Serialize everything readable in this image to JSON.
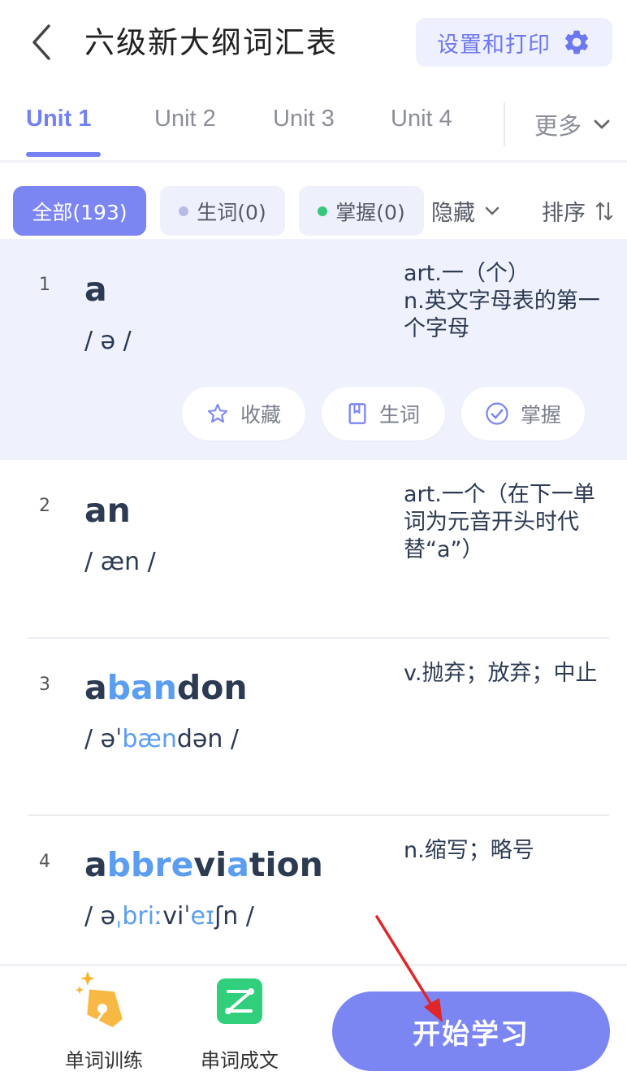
{
  "header": {
    "title": "六级新大纲词汇表",
    "settings_label": "设置和打印"
  },
  "tabs": {
    "items": [
      "Unit 1",
      "Unit 2",
      "Unit 3",
      "Unit 4"
    ],
    "active": "Unit 1",
    "more_label": "更多"
  },
  "filters": {
    "all_label": "全部(193)",
    "new_label": "生词(0)",
    "known_label": "掌握(0)",
    "hide_label": "隐藏",
    "sort_label": "排序"
  },
  "words": [
    {
      "num": "1",
      "word": "a",
      "word_parts": [
        {
          "t": "a",
          "hl": false
        }
      ],
      "phonetic_parts": [
        {
          "t": "/ ə /",
          "hl": false
        }
      ],
      "meaning": "art.一（个）\nn.英文字母表的第一个字母",
      "selected": true
    },
    {
      "num": "2",
      "word": "an",
      "word_parts": [
        {
          "t": "an",
          "hl": false
        }
      ],
      "phonetic_parts": [
        {
          "t": "/ æn /",
          "hl": false
        }
      ],
      "meaning": "art.一个（在下一单词为元音开头时代替“a”）",
      "selected": false
    },
    {
      "num": "3",
      "word": "abandon",
      "word_parts": [
        {
          "t": "a",
          "hl": false
        },
        {
          "t": "ban",
          "hl": true
        },
        {
          "t": "don",
          "hl": false
        }
      ],
      "phonetic_parts": [
        {
          "t": "/ əˈ",
          "hl": false
        },
        {
          "t": "bæn",
          "hl": true
        },
        {
          "t": "dən /",
          "hl": false
        }
      ],
      "meaning": "v.抛弃；放弃；中止",
      "selected": false
    },
    {
      "num": "4",
      "word": "abbreviation",
      "word_parts": [
        {
          "t": "a",
          "hl": false
        },
        {
          "t": "bbre",
          "hl": true
        },
        {
          "t": "vi",
          "hl": false
        },
        {
          "t": "a",
          "hl": true
        },
        {
          "t": "tion",
          "hl": false
        }
      ],
      "phonetic_parts": [
        {
          "t": "/ ə",
          "hl": false
        },
        {
          "t": "ˌbriː",
          "hl": true
        },
        {
          "t": "viˈ",
          "hl": false
        },
        {
          "t": "eɪ",
          "hl": true
        },
        {
          "t": "ʃn /",
          "hl": false
        }
      ],
      "meaning": "n.缩写；略号",
      "selected": false
    }
  ],
  "row_actions": {
    "favorite_label": "收藏",
    "new_word_label": "生词",
    "master_label": "掌握"
  },
  "bottom": {
    "train_label": "单词训练",
    "compose_label": "串词成文",
    "start_label": "开始学习"
  },
  "colors": {
    "accent": "#7b86f3",
    "highlight": "#5b9df0",
    "selected_row": "#eff2fd",
    "arrow": "#e0262b"
  }
}
